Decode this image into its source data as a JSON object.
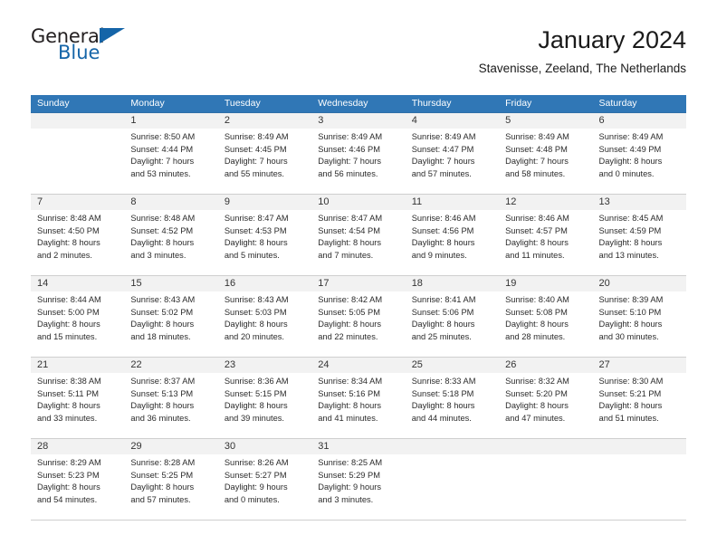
{
  "brand": {
    "name_part1": "General",
    "name_part2": "Blue",
    "triangle_icon": "blue-triangle-icon",
    "accent_color": "#1565a8"
  },
  "header": {
    "title": "January 2024",
    "location": "Stavenisse, Zeeland, The Netherlands"
  },
  "calendar": {
    "header_background": "#3077b6",
    "daynum_background": "#f2f2f2",
    "weekday_headers": [
      "Sunday",
      "Monday",
      "Tuesday",
      "Wednesday",
      "Thursday",
      "Friday",
      "Saturday"
    ],
    "labels": {
      "sunrise": "Sunrise:",
      "sunset": "Sunset:",
      "daylight": "Daylight:"
    },
    "weeks": [
      [
        {
          "day": ""
        },
        {
          "day": "1",
          "l1": "Sunrise: 8:50 AM",
          "l2": "Sunset: 4:44 PM",
          "l3": "Daylight: 7 hours",
          "l4": "and 53 minutes."
        },
        {
          "day": "2",
          "l1": "Sunrise: 8:49 AM",
          "l2": "Sunset: 4:45 PM",
          "l3": "Daylight: 7 hours",
          "l4": "and 55 minutes."
        },
        {
          "day": "3",
          "l1": "Sunrise: 8:49 AM",
          "l2": "Sunset: 4:46 PM",
          "l3": "Daylight: 7 hours",
          "l4": "and 56 minutes."
        },
        {
          "day": "4",
          "l1": "Sunrise: 8:49 AM",
          "l2": "Sunset: 4:47 PM",
          "l3": "Daylight: 7 hours",
          "l4": "and 57 minutes."
        },
        {
          "day": "5",
          "l1": "Sunrise: 8:49 AM",
          "l2": "Sunset: 4:48 PM",
          "l3": "Daylight: 7 hours",
          "l4": "and 58 minutes."
        },
        {
          "day": "6",
          "l1": "Sunrise: 8:49 AM",
          "l2": "Sunset: 4:49 PM",
          "l3": "Daylight: 8 hours",
          "l4": "and 0 minutes."
        }
      ],
      [
        {
          "day": "7",
          "l1": "Sunrise: 8:48 AM",
          "l2": "Sunset: 4:50 PM",
          "l3": "Daylight: 8 hours",
          "l4": "and 2 minutes."
        },
        {
          "day": "8",
          "l1": "Sunrise: 8:48 AM",
          "l2": "Sunset: 4:52 PM",
          "l3": "Daylight: 8 hours",
          "l4": "and 3 minutes."
        },
        {
          "day": "9",
          "l1": "Sunrise: 8:47 AM",
          "l2": "Sunset: 4:53 PM",
          "l3": "Daylight: 8 hours",
          "l4": "and 5 minutes."
        },
        {
          "day": "10",
          "l1": "Sunrise: 8:47 AM",
          "l2": "Sunset: 4:54 PM",
          "l3": "Daylight: 8 hours",
          "l4": "and 7 minutes."
        },
        {
          "day": "11",
          "l1": "Sunrise: 8:46 AM",
          "l2": "Sunset: 4:56 PM",
          "l3": "Daylight: 8 hours",
          "l4": "and 9 minutes."
        },
        {
          "day": "12",
          "l1": "Sunrise: 8:46 AM",
          "l2": "Sunset: 4:57 PM",
          "l3": "Daylight: 8 hours",
          "l4": "and 11 minutes."
        },
        {
          "day": "13",
          "l1": "Sunrise: 8:45 AM",
          "l2": "Sunset: 4:59 PM",
          "l3": "Daylight: 8 hours",
          "l4": "and 13 minutes."
        }
      ],
      [
        {
          "day": "14",
          "l1": "Sunrise: 8:44 AM",
          "l2": "Sunset: 5:00 PM",
          "l3": "Daylight: 8 hours",
          "l4": "and 15 minutes."
        },
        {
          "day": "15",
          "l1": "Sunrise: 8:43 AM",
          "l2": "Sunset: 5:02 PM",
          "l3": "Daylight: 8 hours",
          "l4": "and 18 minutes."
        },
        {
          "day": "16",
          "l1": "Sunrise: 8:43 AM",
          "l2": "Sunset: 5:03 PM",
          "l3": "Daylight: 8 hours",
          "l4": "and 20 minutes."
        },
        {
          "day": "17",
          "l1": "Sunrise: 8:42 AM",
          "l2": "Sunset: 5:05 PM",
          "l3": "Daylight: 8 hours",
          "l4": "and 22 minutes."
        },
        {
          "day": "18",
          "l1": "Sunrise: 8:41 AM",
          "l2": "Sunset: 5:06 PM",
          "l3": "Daylight: 8 hours",
          "l4": "and 25 minutes."
        },
        {
          "day": "19",
          "l1": "Sunrise: 8:40 AM",
          "l2": "Sunset: 5:08 PM",
          "l3": "Daylight: 8 hours",
          "l4": "and 28 minutes."
        },
        {
          "day": "20",
          "l1": "Sunrise: 8:39 AM",
          "l2": "Sunset: 5:10 PM",
          "l3": "Daylight: 8 hours",
          "l4": "and 30 minutes."
        }
      ],
      [
        {
          "day": "21",
          "l1": "Sunrise: 8:38 AM",
          "l2": "Sunset: 5:11 PM",
          "l3": "Daylight: 8 hours",
          "l4": "and 33 minutes."
        },
        {
          "day": "22",
          "l1": "Sunrise: 8:37 AM",
          "l2": "Sunset: 5:13 PM",
          "l3": "Daylight: 8 hours",
          "l4": "and 36 minutes."
        },
        {
          "day": "23",
          "l1": "Sunrise: 8:36 AM",
          "l2": "Sunset: 5:15 PM",
          "l3": "Daylight: 8 hours",
          "l4": "and 39 minutes."
        },
        {
          "day": "24",
          "l1": "Sunrise: 8:34 AM",
          "l2": "Sunset: 5:16 PM",
          "l3": "Daylight: 8 hours",
          "l4": "and 41 minutes."
        },
        {
          "day": "25",
          "l1": "Sunrise: 8:33 AM",
          "l2": "Sunset: 5:18 PM",
          "l3": "Daylight: 8 hours",
          "l4": "and 44 minutes."
        },
        {
          "day": "26",
          "l1": "Sunrise: 8:32 AM",
          "l2": "Sunset: 5:20 PM",
          "l3": "Daylight: 8 hours",
          "l4": "and 47 minutes."
        },
        {
          "day": "27",
          "l1": "Sunrise: 8:30 AM",
          "l2": "Sunset: 5:21 PM",
          "l3": "Daylight: 8 hours",
          "l4": "and 51 minutes."
        }
      ],
      [
        {
          "day": "28",
          "l1": "Sunrise: 8:29 AM",
          "l2": "Sunset: 5:23 PM",
          "l3": "Daylight: 8 hours",
          "l4": "and 54 minutes."
        },
        {
          "day": "29",
          "l1": "Sunrise: 8:28 AM",
          "l2": "Sunset: 5:25 PM",
          "l3": "Daylight: 8 hours",
          "l4": "and 57 minutes."
        },
        {
          "day": "30",
          "l1": "Sunrise: 8:26 AM",
          "l2": "Sunset: 5:27 PM",
          "l3": "Daylight: 9 hours",
          "l4": "and 0 minutes."
        },
        {
          "day": "31",
          "l1": "Sunrise: 8:25 AM",
          "l2": "Sunset: 5:29 PM",
          "l3": "Daylight: 9 hours",
          "l4": "and 3 minutes."
        },
        {
          "day": ""
        },
        {
          "day": ""
        },
        {
          "day": ""
        }
      ]
    ]
  }
}
